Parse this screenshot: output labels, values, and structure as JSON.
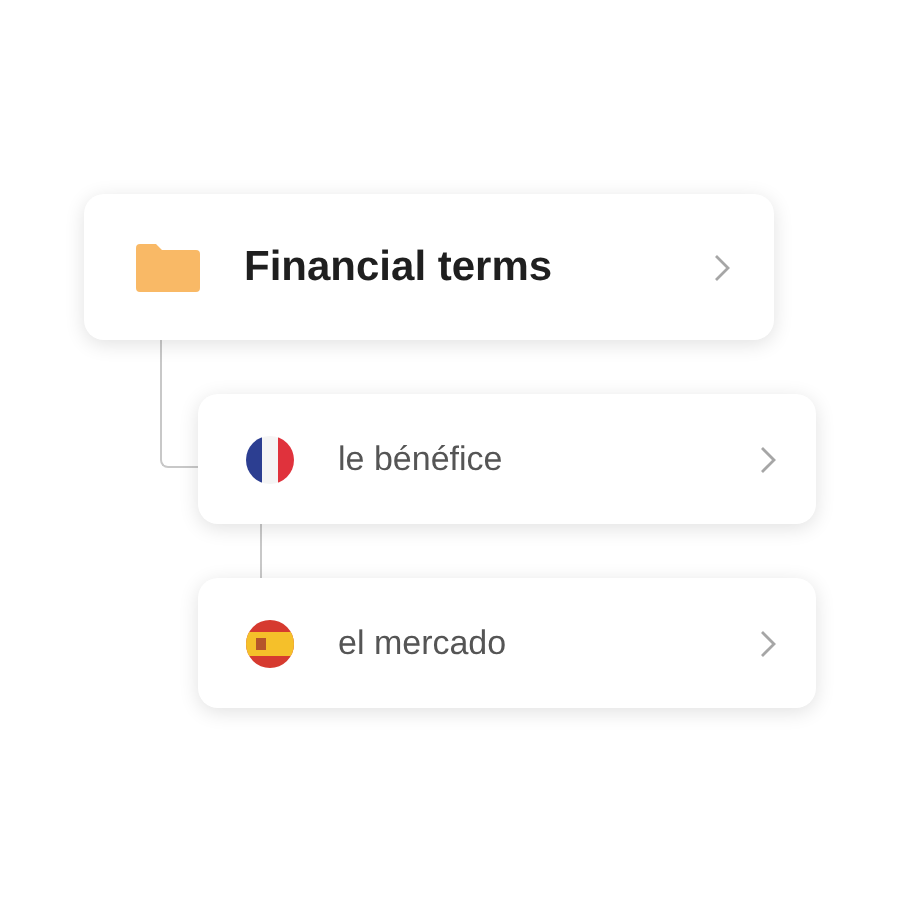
{
  "folder": {
    "label": "Financial terms",
    "children": [
      {
        "label": "le bénéfice",
        "kind": "fr",
        "children": [
          {
            "label": "el mercado",
            "kind": "es"
          }
        ]
      }
    ]
  }
}
